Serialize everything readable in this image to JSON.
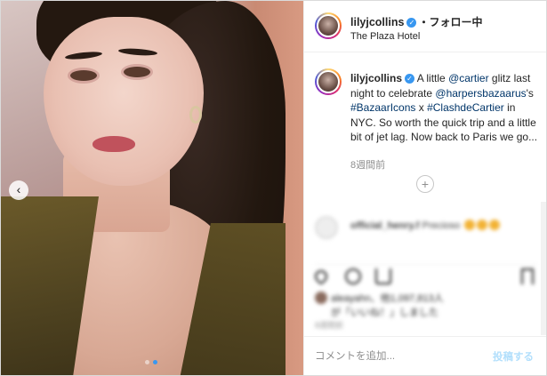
{
  "post": {
    "username": "lilyjcollins",
    "follow_text": "・フォロー中",
    "location": "The Plaza Hotel",
    "verified_mark": "✓",
    "caption": {
      "username": "lilyjcollins",
      "part1": "A little ",
      "mention1": "@cartier",
      "part2": " glitz last night to celebrate ",
      "mention2": "@harpersbazaarus",
      "part3": "'s ",
      "hashtag1": "#BazaarIcons",
      "part4": " x ",
      "hashtag2": "#ClashdeCartier",
      "part5": " in NYC. So worth the quick trip and a little bit of jet lag. Now back to Paris we go...",
      "age": "8週間前"
    },
    "load_more_icon": "+",
    "blurred_comment": {
      "username": "official_henry.f",
      "text": "Precioso"
    },
    "likes": {
      "line1": "aleayahn、他1,097,813人",
      "line2": "が「いいね！」しました"
    },
    "date_small": "8週間前",
    "comment_box": {
      "placeholder": "コメントを追加...",
      "post_label": "投稿する"
    },
    "nav_prev_icon": "‹"
  },
  "colors": {
    "verified": "#3897f0",
    "link": "#003569",
    "muted": "#8e8e8e",
    "post_button_disabled": "#b2dffc"
  }
}
